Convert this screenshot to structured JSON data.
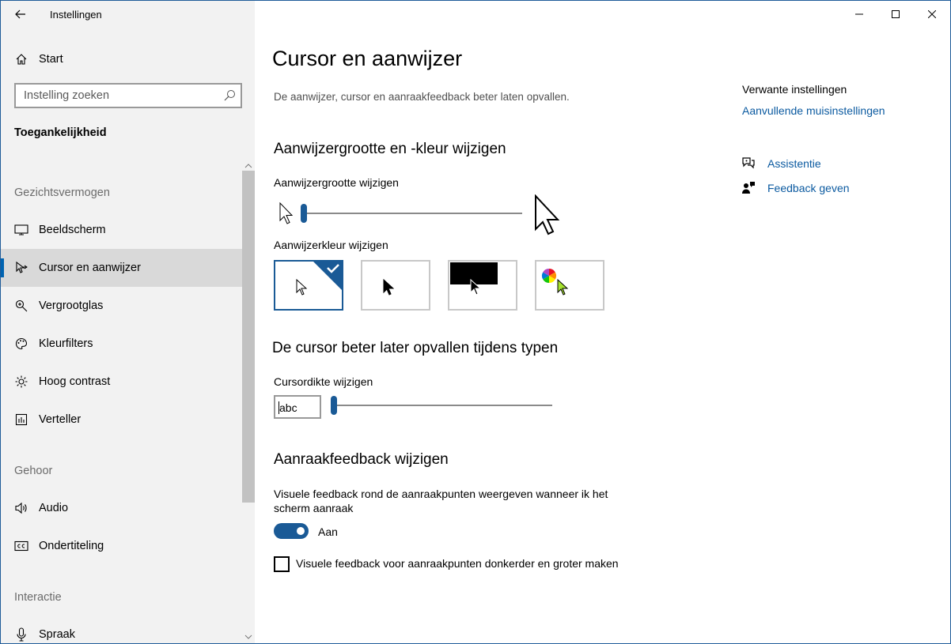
{
  "window": {
    "app_title": "Instellingen",
    "minimize_icon": "minimize-icon",
    "maximize_icon": "maximize-icon",
    "close_icon": "close-icon"
  },
  "sidebar": {
    "home_label": "Start",
    "search_placeholder": "Instelling zoeken",
    "section_title": "Toegankelijkheid",
    "groups": [
      {
        "label": "Gezichtsvermogen",
        "items": [
          {
            "label": "Beeldscherm",
            "icon": "monitor-icon"
          },
          {
            "label": "Cursor en aanwijzer",
            "icon": "cursor-icon",
            "selected": true
          },
          {
            "label": "Vergrootglas",
            "icon": "magnifier-icon"
          },
          {
            "label": "Kleurfilters",
            "icon": "palette-icon"
          },
          {
            "label": "Hoog contrast",
            "icon": "sun-icon"
          },
          {
            "label": "Verteller",
            "icon": "narrator-icon"
          }
        ]
      },
      {
        "label": "Gehoor",
        "items": [
          {
            "label": "Audio",
            "icon": "speaker-icon"
          },
          {
            "label": "Ondertiteling",
            "icon": "captions-icon"
          }
        ]
      },
      {
        "label": "Interactie",
        "items": [
          {
            "label": "Spraak",
            "icon": "microphone-icon"
          }
        ]
      }
    ]
  },
  "main": {
    "page_title": "Cursor en aanwijzer",
    "description": "De aanwijzer, cursor en aanraakfeedback beter laten opvallen.",
    "pointer_section": {
      "title": "Aanwijzergrootte en -kleur wijzigen",
      "size_label": "Aanwijzergrootte wijzigen",
      "size_value": 0.0,
      "color_label": "Aanwijzerkleur wijzigen",
      "color_options": [
        "white",
        "black",
        "inverted",
        "custom"
      ],
      "selected_color": "white"
    },
    "cursor_section": {
      "title": "De cursor beter later opvallen tijdens typen",
      "thickness_label": "Cursordikte wijzigen",
      "preview_text": "abc",
      "thickness_value": 0.0
    },
    "touch_section": {
      "title": "Aanraakfeedback wijzigen",
      "visual_feedback_label_line1": "Visuele feedback rond de aanraakpunten weergeven wanneer ik het",
      "visual_feedback_label_line2": "scherm aanraak",
      "toggle_state": "Aan",
      "darker_larger_label": "Visuele feedback voor aanraakpunten donkerder en groter maken",
      "darker_larger_checked": false
    }
  },
  "related": {
    "title": "Verwante instellingen",
    "mouse_link": "Aanvullende muisinstellingen",
    "help_link": "Assistentie",
    "feedback_link": "Feedback geven"
  },
  "colors": {
    "accent": "#1a5a96",
    "link": "#0b5aa0",
    "sidebar_bg": "#f2f2f2",
    "selected_bg": "#d9d9d9"
  }
}
